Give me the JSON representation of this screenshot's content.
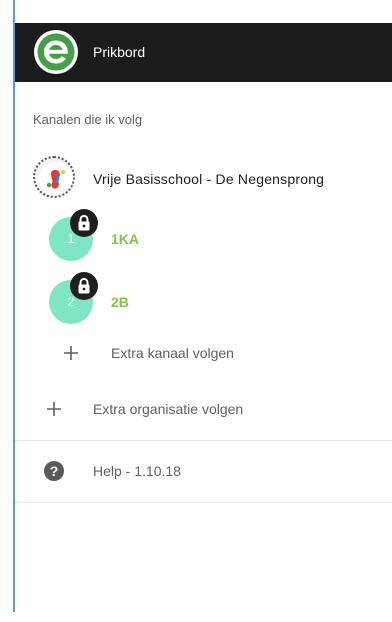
{
  "app_bar": {
    "title": "Prikbord",
    "logo_icon": "e-logo-icon",
    "background": "#1c1c1c",
    "logo_color": "#43a047"
  },
  "followed_section": {
    "label": "Kanalen die ik volg"
  },
  "organization": {
    "name": "Vrije Basisschool - De Negensprong"
  },
  "channels": [
    {
      "initial": "1",
      "name": "1KA",
      "locked": true
    },
    {
      "initial": "2",
      "name": "2B",
      "locked": true
    }
  ],
  "actions": {
    "follow_channel": "Extra kanaal volgen",
    "follow_organization": "Extra organisatie volgen"
  },
  "help": {
    "label": "Help - 1.10.18"
  },
  "colors": {
    "channel_avatar": "#7ee6c4",
    "channel_name": "#8bc34a",
    "accent_rule": "#5b9bd5"
  }
}
